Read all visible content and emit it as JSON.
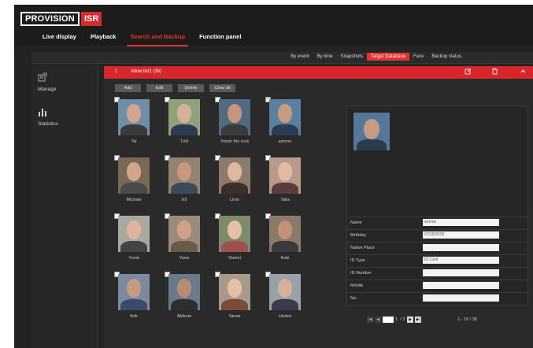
{
  "header": {
    "brand_main": "PROVISION",
    "brand_accent": "ISR",
    "nav": [
      {
        "label": "Live display"
      },
      {
        "label": "Playback"
      },
      {
        "label": "Search and Backup"
      },
      {
        "label": "Function panel"
      }
    ]
  },
  "subtabs": [
    "By event",
    "By time",
    "Snapshots",
    "Target Database",
    "Face",
    "Backup status"
  ],
  "sidebar": {
    "manage_label": "Manage",
    "statistics_label": "Statistics"
  },
  "list": {
    "index": "1",
    "title": "Allow list1 (36)"
  },
  "actions": {
    "add": "Add",
    "edit": "Edit",
    "delete": "Delete",
    "clear_all": "Clear all"
  },
  "faces": [
    {
      "name": "Tal",
      "checked": false
    },
    {
      "name": "Tzlil",
      "checked": false
    },
    {
      "name": "Yotam the rock",
      "checked": false
    },
    {
      "name": "amnon",
      "checked": true
    },
    {
      "name": "Michael",
      "checked": false
    },
    {
      "name": "Eli",
      "checked": false
    },
    {
      "name": "Liron",
      "checked": false
    },
    {
      "name": "Talia",
      "checked": false
    },
    {
      "name": "Yuval",
      "checked": false
    },
    {
      "name": "Yaniv",
      "checked": false
    },
    {
      "name": "Daniel",
      "checked": false
    },
    {
      "name": "Kobi",
      "checked": false
    },
    {
      "name": "Itzik",
      "checked": false
    },
    {
      "name": "Abikum",
      "checked": false
    },
    {
      "name": "Tamar",
      "checked": false
    },
    {
      "name": "Hedva",
      "checked": false
    }
  ],
  "detail": {
    "fields": [
      {
        "label": "Name",
        "value": "amnon"
      },
      {
        "label": "Birthday",
        "value": "07/15/2018"
      },
      {
        "label": "Native Place",
        "value": ""
      },
      {
        "label": "ID Type",
        "value": "ID Card"
      },
      {
        "label": "ID Number",
        "value": ""
      },
      {
        "label": "Mobile",
        "value": ""
      },
      {
        "label": "No.",
        "value": ""
      }
    ]
  },
  "pager": {
    "current_page": "1",
    "total_pages": "/ 3",
    "range": "1 - 16 / 36"
  },
  "colors": {
    "accent": "#e53232",
    "background": "#232323"
  }
}
